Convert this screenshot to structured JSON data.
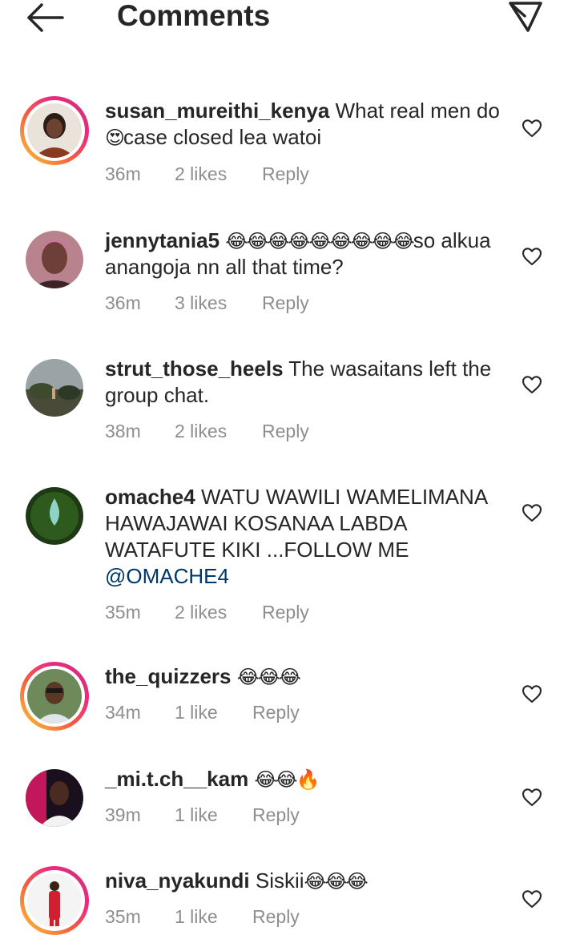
{
  "header": {
    "title": "Comments"
  },
  "comments": [
    {
      "username": "susan_mureithi_kenya",
      "text_parts": [
        "What real men do ",
        "😍",
        "case closed  lea watoi"
      ],
      "time": "36m",
      "likes": "2 likes",
      "reply": "Reply"
    },
    {
      "username": "jennytania5",
      "text_parts": [
        "😂😂😂😂😂😂😂😂😂",
        "so alkua anangoja nn all that time?"
      ],
      "time": "36m",
      "likes": "3 likes",
      "reply": "Reply"
    },
    {
      "username": "strut_those_heels",
      "text_parts": [
        "The wasaitans left the group chat."
      ],
      "time": "38m",
      "likes": "2 likes",
      "reply": "Reply"
    },
    {
      "username": "omache4",
      "text_parts": [
        "WATU WAWILI WAMELIMANA HAWAJAWAI KOSANAA LABDA WATAFUTE KIKI ...FOLLOW ME ",
        "@OMACHE4"
      ],
      "time": "35m",
      "likes": "2 likes",
      "reply": "Reply"
    },
    {
      "username": "the_quizzers",
      "text_parts": [
        "😂😂😂"
      ],
      "time": "34m",
      "likes": "1 like",
      "reply": "Reply"
    },
    {
      "username": "_mi.t.ch__kam",
      "text_parts": [
        "😂😂🔥"
      ],
      "time": "39m",
      "likes": "1 like",
      "reply": "Reply"
    },
    {
      "username": "niva_nyakundi",
      "text_parts": [
        "Siskii",
        "😂😂😂"
      ],
      "time": "35m",
      "likes": "1 like",
      "reply": "Reply"
    }
  ],
  "icons": {
    "back": "arrow-left-icon",
    "send": "paper-plane-icon",
    "like": "heart-outline-icon"
  },
  "colors": {
    "mention": "#00376b",
    "meta": "#8e8e8e",
    "story_ring": "#ee2a7b"
  }
}
